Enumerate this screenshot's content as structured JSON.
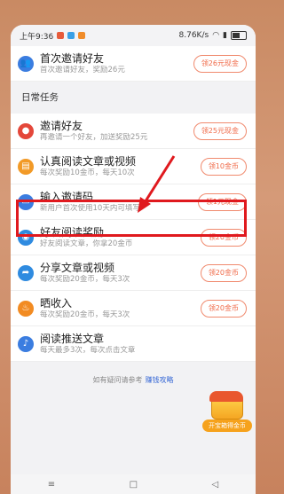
{
  "status_bar": {
    "time": "上午9:36",
    "speed": "8.76K/s"
  },
  "top_task": {
    "title": "首次邀请好友",
    "subtitle": "首次邀请好友，奖励26元",
    "button": "领26元现金"
  },
  "section_title": "日常任务",
  "daily_tasks": [
    {
      "title": "邀请好友",
      "subtitle": "再邀请一个好友，加送奖励25元",
      "button": "领25元现金",
      "icon": "people-icon",
      "color": "#e4473a"
    },
    {
      "title": "认真阅读文章或视频",
      "subtitle": "每次奖励10金币，每天10次",
      "button": "领10金币",
      "icon": "book-icon",
      "color": "#f29a27"
    },
    {
      "title": "输入邀请码",
      "subtitle": "新用户首次使用10天内可填写",
      "button": "领1元现金",
      "icon": "code-icon",
      "color": "#3b7de0"
    },
    {
      "title": "好友阅读奖励",
      "subtitle": "好友阅读文章，你拿20金币",
      "button": "领20金币",
      "icon": "eye-icon",
      "color": "#2f8be0"
    },
    {
      "title": "分享文章或视频",
      "subtitle": "每次奖励20金币，每天3次",
      "button": "领20金币",
      "icon": "share-icon",
      "color": "#2f8be0"
    },
    {
      "title": "晒收入",
      "subtitle": "每次奖励20金币，每天3次",
      "button": "领20金币",
      "icon": "fire-icon",
      "color": "#f28b22"
    },
    {
      "title": "阅读推送文章",
      "subtitle": "每天最多3次，每次点击文章",
      "button": "",
      "icon": "bell-icon",
      "color": "#3b7de0"
    }
  ],
  "treasure_label": "开宝箱得金币",
  "footer": {
    "text": "如有疑问请参考",
    "link": "赚钱攻略"
  },
  "nav": {
    "menu": "≡",
    "home": "□",
    "back": "◁"
  }
}
